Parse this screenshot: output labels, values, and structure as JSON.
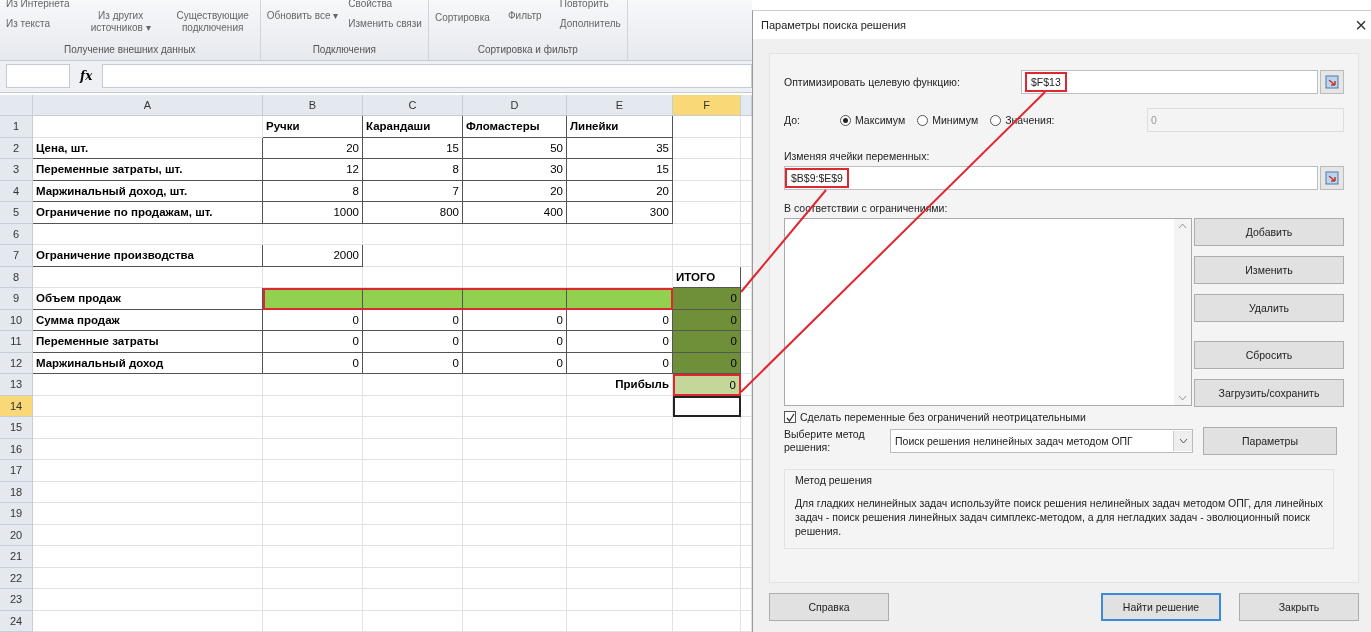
{
  "ribbon": {
    "groups": [
      {
        "label": "Получение внешних данных",
        "items": [
          {
            "kind": "small",
            "labels": [
              "Из Интернета",
              "Из текста"
            ]
          },
          {
            "kind": "big",
            "label": "Из других источников ▾"
          },
          {
            "kind": "big",
            "label": "Существующие подключения"
          }
        ]
      },
      {
        "label": "Подключения",
        "items": [
          {
            "kind": "big",
            "label": "Обновить все ▾"
          },
          {
            "kind": "small",
            "labels": [
              "Свойства",
              "Изменить связи"
            ]
          }
        ]
      },
      {
        "label": "Сортировка и фильтр",
        "items": [
          {
            "kind": "sort",
            "label": "Сортировка"
          },
          {
            "kind": "big",
            "label": "Фильтр"
          },
          {
            "kind": "small",
            "labels": [
              "Повторить",
              "Дополнитель"
            ]
          }
        ]
      }
    ]
  },
  "formula_bar": {
    "fx": "fx"
  },
  "sheet": {
    "columns": [
      {
        "label": "A",
        "selected": false
      },
      {
        "label": "B",
        "selected": false
      },
      {
        "label": "C",
        "selected": false
      },
      {
        "label": "D",
        "selected": false
      },
      {
        "label": "E",
        "selected": false
      },
      {
        "label": "F",
        "selected": true
      },
      {
        "selected": false
      }
    ],
    "rows": [
      {
        "number": "1",
        "selected": false,
        "cells": {
          "B": "Ручки",
          "C": "Карандаши",
          "D": "Фломастеры",
          "E": "Линейки"
        }
      },
      {
        "number": "2",
        "selected": false,
        "cells": {
          "A": "Цена, шт.",
          "B": "20",
          "C": "15",
          "D": "50",
          "E": "35"
        }
      },
      {
        "number": "3",
        "selected": false,
        "cells": {
          "A": "Переменные затраты, шт.",
          "B": "12",
          "C": "8",
          "D": "30",
          "E": "15"
        }
      },
      {
        "number": "4",
        "selected": false,
        "cells": {
          "A": "Маржинальный доход, шт.",
          "B": "8",
          "C": "7",
          "D": "20",
          "E": "20"
        }
      },
      {
        "number": "5",
        "selected": false,
        "cells": {
          "A": "Ограничение по продажам, шт.",
          "B": "1000",
          "C": "800",
          "D": "400",
          "E": "300"
        }
      },
      {
        "number": "6",
        "selected": false,
        "cells": {}
      },
      {
        "number": "7",
        "selected": false,
        "cells": {
          "A": "Ограничение производства",
          "B": "2000"
        }
      },
      {
        "number": "8",
        "selected": false,
        "cells": {
          "F": "ИТОГО"
        }
      },
      {
        "number": "9",
        "selected": false,
        "cells": {
          "A": "Объем продаж",
          "B": {
            "color": "#92d050",
            "outlined": true
          },
          "C": {
            "color": "#92d050",
            "outlined": true
          },
          "D": {
            "color": "#92d050",
            "outlined": true
          },
          "E": {
            "color": "#92d050",
            "outlined": true
          },
          "F": {
            "text": "0",
            "color": "#6f8f38"
          }
        }
      },
      {
        "number": "10",
        "selected": false,
        "cells": {
          "A": "Сумма продаж",
          "B": "0",
          "C": "0",
          "D": "0",
          "E": "0",
          "F": {
            "text": "0",
            "color": "#6f8f38"
          }
        }
      },
      {
        "number": "11",
        "selected": false,
        "cells": {
          "A": "Переменные затраты",
          "B": "0",
          "C": "0",
          "D": "0",
          "E": "0",
          "F": {
            "text": "0",
            "color": "#6f8f38"
          }
        }
      },
      {
        "number": "12",
        "selected": false,
        "cells": {
          "A": "Маржинальный доход",
          "B": "0",
          "C": "0",
          "D": "0",
          "E": "0",
          "F": {
            "text": "0",
            "color": "#6f8f38"
          }
        }
      },
      {
        "number": "13",
        "selected": false,
        "cells": {
          "E": {
            "text": "Прибыль",
            "align_right": true
          },
          "F": {
            "text": "0",
            "color": "#c4d79b",
            "outlined": true
          }
        }
      },
      {
        "number": "14",
        "selected": true,
        "cells": {
          "F": {
            "active": true
          }
        }
      },
      {
        "number": "15",
        "selected": false,
        "cells": {}
      },
      {
        "number": "16",
        "selected": false,
        "cells": {}
      },
      {
        "number": "17",
        "selected": false,
        "cells": {}
      },
      {
        "number": "18",
        "selected": false,
        "cells": {}
      },
      {
        "number": "19",
        "selected": false,
        "cells": {}
      },
      {
        "number": "20",
        "selected": false,
        "cells": {}
      },
      {
        "number": "21",
        "selected": false,
        "cells": {}
      },
      {
        "number": "22",
        "selected": false,
        "cells": {}
      },
      {
        "number": "23",
        "selected": false,
        "cells": {}
      },
      {
        "number": "24",
        "selected": false,
        "cells": {}
      }
    ]
  },
  "dialog": {
    "title": "Параметры поиска решения",
    "close": "×",
    "objective": {
      "label": "Оптимизировать целевую функцию:",
      "value": "$F$13",
      "outlined": true
    },
    "to": {
      "label": "До:",
      "options": [
        {
          "label": "Максимум",
          "selected": true
        },
        {
          "label": "Минимум",
          "selected": false
        },
        {
          "label": "Значения:",
          "selected": false
        }
      ],
      "value": "0",
      "value_disabled": true
    },
    "variables": {
      "label": "Изменяя ячейки переменных:",
      "value": "$B$9:$E$9",
      "outlined": true
    },
    "constraints": {
      "label": "В соответствии с ограничениями:"
    },
    "side_buttons": [
      "Добавить",
      "Изменить",
      "Удалить",
      "Сбросить",
      "Загрузить/сохранить"
    ],
    "nonnegative": {
      "label": "Сделать переменные без ограничений неотрицательными",
      "checked": true
    },
    "method": {
      "label": "Выберите метод решения:",
      "value": "Поиск решения нелинейных задач методом ОПГ",
      "button": "Параметры"
    },
    "method_group": {
      "title": "Метод решения",
      "text": "Для гладких нелинейных задач используйте поиск решения нелинейных задач методом ОПГ, для линейных задач - поиск решения линейных задач симплекс-методом, а для негладких задач - эволюционный поиск решения."
    },
    "buttons": [
      {
        "label": "Справка",
        "default": false
      },
      {
        "label": "Найти решение",
        "default": true
      },
      {
        "label": "Закрыть",
        "default": false
      }
    ]
  }
}
